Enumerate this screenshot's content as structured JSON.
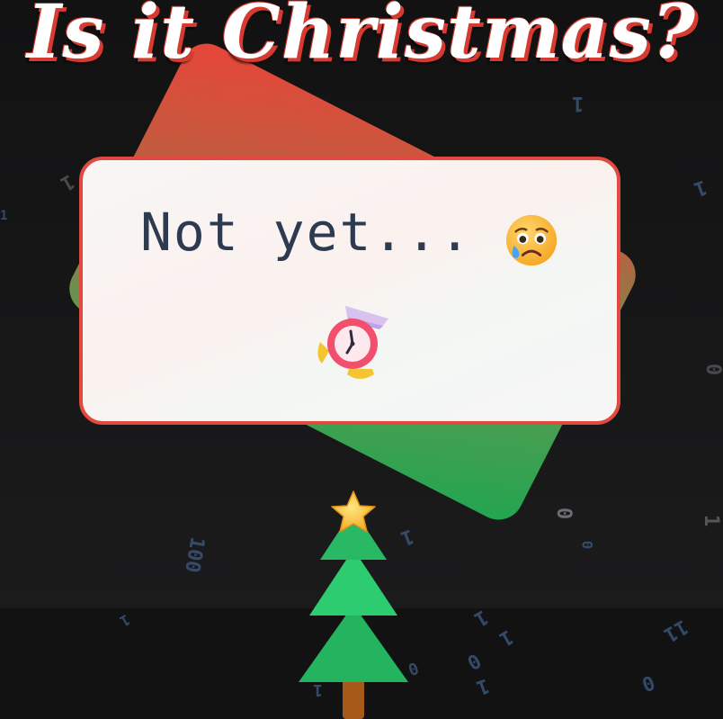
{
  "title": "Is it Christmas?",
  "answer": {
    "text": "Not yet...",
    "emoji": "sad-tear-face-icon",
    "icon": "alarm-clock-icon"
  },
  "tree": {
    "topper": "star-icon"
  },
  "background": {
    "digits": [
      "1",
      "1",
      "1",
      "1",
      "1",
      "0",
      "100",
      "1",
      "0",
      "0",
      "1",
      "1",
      "0",
      "1",
      "1",
      "0",
      "1",
      "11",
      "1",
      "0"
    ]
  },
  "colors": {
    "accent_red": "#e14a3e",
    "accent_green": "#21a650",
    "background": "#1a1a1b",
    "text": "#2d3a4f"
  }
}
